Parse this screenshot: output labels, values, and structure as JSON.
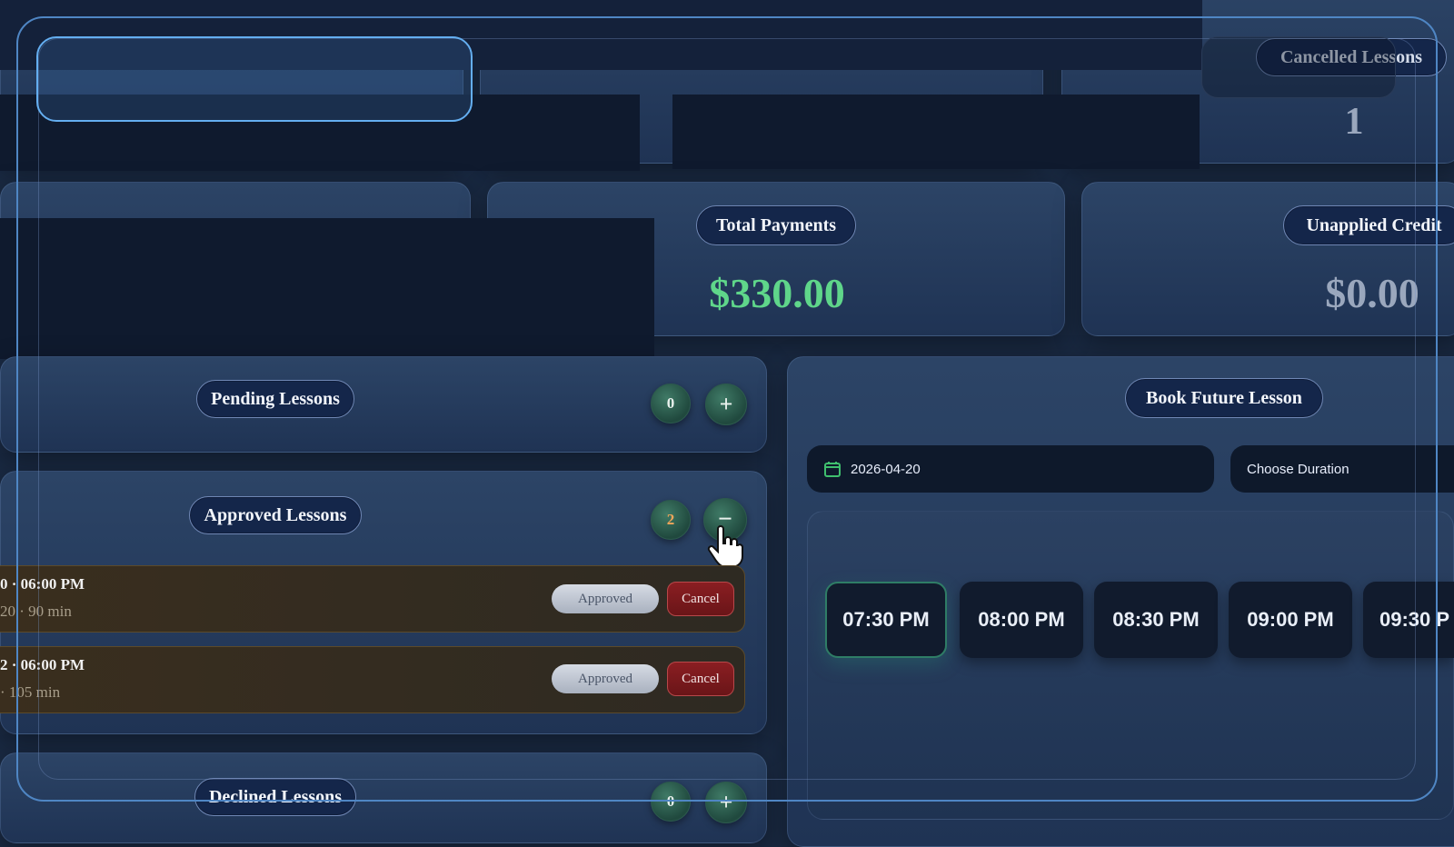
{
  "stats": {
    "cancelled_label": "Cancelled Lessons",
    "cancelled_value": "1",
    "total_payments_label": "Total Payments",
    "total_payments_value": "$330.00",
    "unapplied_credit_label": "Unapplied Credit",
    "unapplied_credit_value": "$0.00"
  },
  "lessons": {
    "pending_label": "Pending Lessons",
    "pending_count": "0",
    "approved_label": "Approved Lessons",
    "approved_count": "2",
    "declined_label": "Declined Lessons",
    "declined_count": "0",
    "approved_items": [
      {
        "line1": "0 · 06:00 PM",
        "line2": "20 · 90 min",
        "status": "Approved",
        "cancel": "Cancel"
      },
      {
        "line1": "2 · 06:00 PM",
        "line2": "· 105 min",
        "status": "Approved",
        "cancel": "Cancel"
      }
    ]
  },
  "booking": {
    "title": "Book Future Lesson",
    "date": "2026-04-20",
    "duration_placeholder": "Choose Duration",
    "slots": [
      "07:30 PM",
      "08:00 PM",
      "08:30 PM",
      "09:00 PM",
      "09:30 P"
    ]
  },
  "icons": {
    "expand": "+",
    "collapse": "−"
  },
  "colors": {
    "accent_green": "#5fd68a",
    "credit_gray": "#9aa7bd",
    "cancel_red": "#7a1a1d"
  }
}
